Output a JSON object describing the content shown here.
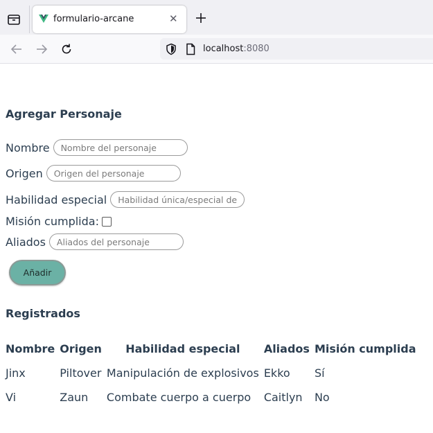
{
  "browser": {
    "tab_title": "formulario-arcane",
    "url_host": "localhost",
    "url_port": ":8080",
    "icons": [
      "tab-overview-icon",
      "vue-favicon-icon",
      "close-icon",
      "plus-icon",
      "back-arrow-icon",
      "forward-arrow-icon",
      "reload-icon",
      "shield-icon",
      "page-icon"
    ],
    "accent_colors": {
      "vue_green": "#41b883",
      "vue_dark": "#35495e"
    }
  },
  "form": {
    "title": "Agregar Personaje",
    "fields": {
      "nombre": {
        "label": "Nombre",
        "placeholder": "Nombre del personaje",
        "value": ""
      },
      "origen": {
        "label": "Origen",
        "placeholder": "Origen del personaje",
        "value": ""
      },
      "habilidad": {
        "label": "Habilidad especial",
        "placeholder": "Habilidad única/especial del personaje",
        "value": ""
      },
      "mision": {
        "label": "Misión cumplida:",
        "checked": false
      },
      "aliados": {
        "label": "Aliados",
        "placeholder": "Aliados del personaje",
        "value": ""
      }
    },
    "submit_label": "Añadir",
    "button_color": "#6bb1a5"
  },
  "registry": {
    "title": "Registrados",
    "columns": [
      "Nombre",
      "Origen",
      "Habilidad especial",
      "Aliados",
      "Misión cumplida"
    ],
    "rows": [
      [
        "Jinx",
        "Piltover",
        "Manipulación de explosivos",
        "Ekko",
        "Sí"
      ],
      [
        "Vi",
        "Zaun",
        "Combate cuerpo a cuerpo",
        "Caitlyn",
        "No"
      ]
    ]
  }
}
